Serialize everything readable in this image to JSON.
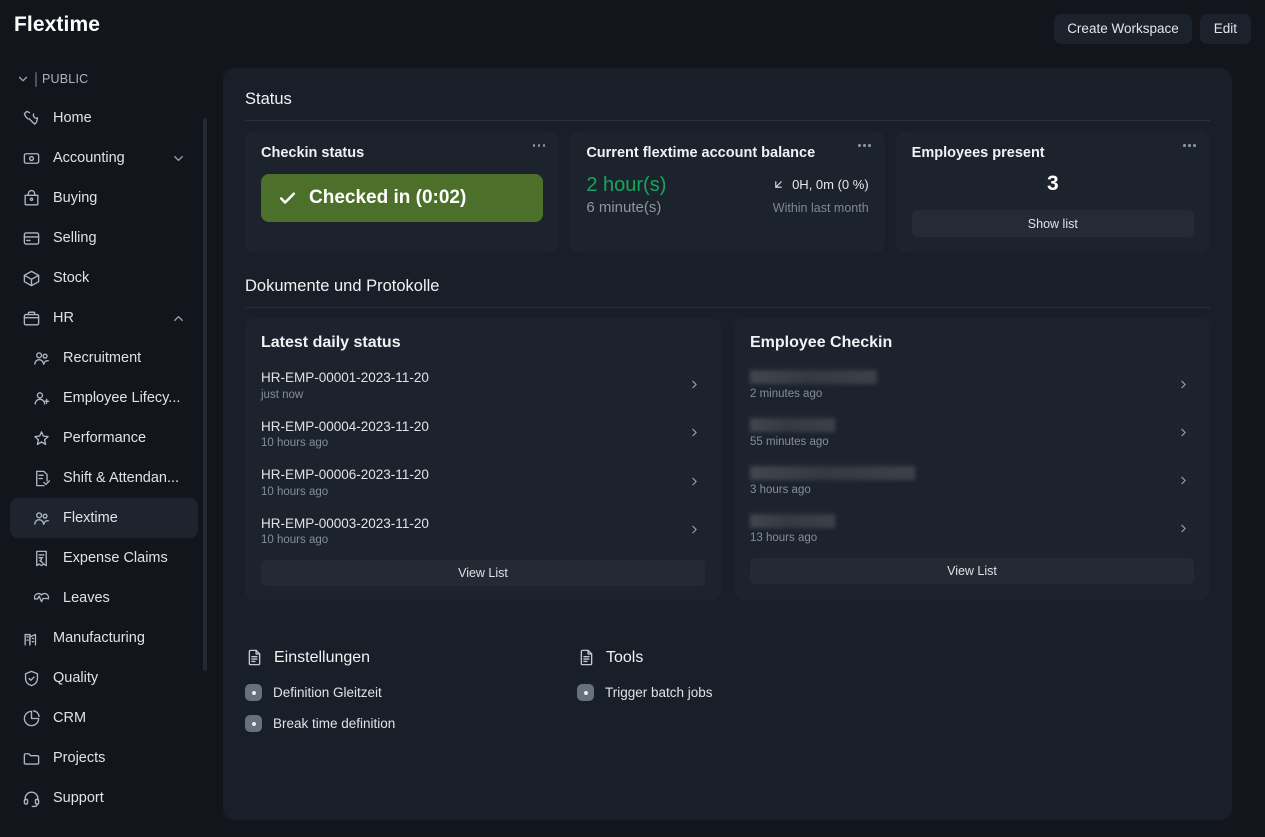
{
  "header": {
    "title": "Flextime",
    "create_workspace_label": "Create Workspace",
    "edit_label": "Edit"
  },
  "sidebar": {
    "workspace_label": "PUBLIC",
    "items": [
      {
        "label": "Home",
        "icon": "tools-icon",
        "level": 0,
        "active": false,
        "caret": ""
      },
      {
        "label": "Accounting",
        "icon": "accounting-icon",
        "level": 0,
        "active": false,
        "caret": "down"
      },
      {
        "label": "Buying",
        "icon": "buying-icon",
        "level": 0,
        "active": false,
        "caret": ""
      },
      {
        "label": "Selling",
        "icon": "selling-icon",
        "level": 0,
        "active": false,
        "caret": ""
      },
      {
        "label": "Stock",
        "icon": "box-icon",
        "level": 0,
        "active": false,
        "caret": ""
      },
      {
        "label": "HR",
        "icon": "briefcase-icon",
        "level": 0,
        "active": false,
        "caret": "up"
      },
      {
        "label": "Recruitment",
        "icon": "users-icon",
        "level": 1,
        "active": false,
        "caret": ""
      },
      {
        "label": "Employee Lifecy...",
        "icon": "user-plus-icon",
        "level": 1,
        "active": false,
        "caret": ""
      },
      {
        "label": "Performance",
        "icon": "star-icon",
        "level": 1,
        "active": false,
        "caret": ""
      },
      {
        "label": "Shift & Attendan...",
        "icon": "checklist-icon",
        "level": 1,
        "active": false,
        "caret": ""
      },
      {
        "label": "Flextime",
        "icon": "users-icon",
        "level": 1,
        "active": true,
        "caret": ""
      },
      {
        "label": "Expense Claims",
        "icon": "receipt-icon",
        "level": 1,
        "active": false,
        "caret": ""
      },
      {
        "label": "Leaves",
        "icon": "pulse-icon",
        "level": 1,
        "active": false,
        "caret": ""
      },
      {
        "label": "Manufacturing",
        "icon": "factory-icon",
        "level": 0,
        "active": false,
        "caret": ""
      },
      {
        "label": "Quality",
        "icon": "shield-check-icon",
        "level": 0,
        "active": false,
        "caret": ""
      },
      {
        "label": "CRM",
        "icon": "pie-chart-icon",
        "level": 0,
        "active": false,
        "caret": ""
      },
      {
        "label": "Projects",
        "icon": "folder-icon",
        "level": 0,
        "active": false,
        "caret": ""
      },
      {
        "label": "Support",
        "icon": "headset-icon",
        "level": 0,
        "active": false,
        "caret": ""
      }
    ]
  },
  "main": {
    "status_section_title": "Status",
    "documents_section_title": "Dokumente und Protokolle",
    "cards": {
      "checkin": {
        "title": "Checkin status",
        "button_label": "Checked in (0:02)",
        "button_color": "#4c7029"
      },
      "balance": {
        "title": "Current flextime account balance",
        "value_hours": "2 hour(s)",
        "value_minutes": "6 minute(s)",
        "value_color": "#15a65c",
        "delta": "0H, 0m (0 %)",
        "delta_direction": "down-left",
        "note": "Within last month"
      },
      "employees": {
        "title": "Employees present",
        "count": "3",
        "button_label": "Show list"
      }
    },
    "latest_daily_status": {
      "title": "Latest daily status",
      "view_list_label": "View List",
      "rows": [
        {
          "primary": "HR-EMP-00001-2023-11-20",
          "secondary": "just now",
          "redacted": false
        },
        {
          "primary": "HR-EMP-00004-2023-11-20",
          "secondary": "10 hours ago",
          "redacted": false
        },
        {
          "primary": "HR-EMP-00006-2023-11-20",
          "secondary": "10 hours ago",
          "redacted": false
        },
        {
          "primary": "HR-EMP-00003-2023-11-20",
          "secondary": "10 hours ago",
          "redacted": false
        }
      ]
    },
    "employee_checkin": {
      "title": "Employee Checkin",
      "view_list_label": "View List",
      "rows": [
        {
          "primary": "",
          "secondary": "2 minutes ago",
          "redacted": true,
          "redact_width": 127
        },
        {
          "primary": "",
          "secondary": "55 minutes ago",
          "redacted": true,
          "redact_width": 85
        },
        {
          "primary": "",
          "secondary": "3 hours ago",
          "redacted": true,
          "redact_width": 165
        },
        {
          "primary": "",
          "secondary": "13 hours ago",
          "redacted": true,
          "redact_width": 85
        }
      ]
    },
    "link_groups": [
      {
        "title": "Einstellungen",
        "items": [
          {
            "label": "Definition Gleitzeit"
          },
          {
            "label": "Break time definition"
          }
        ]
      },
      {
        "title": "Tools",
        "items": [
          {
            "label": "Trigger batch jobs"
          }
        ]
      }
    ]
  }
}
